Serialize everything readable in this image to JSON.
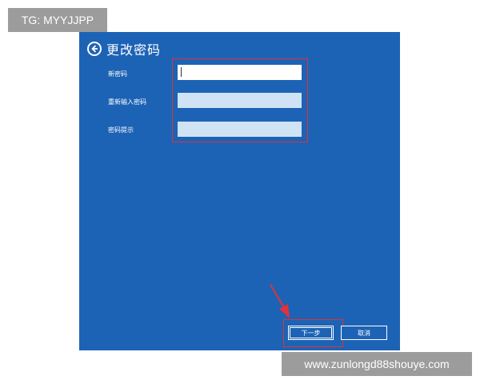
{
  "watermarks": {
    "top": "TG: MYYJJPP",
    "bottom": "www.zunlongd88shouye.com"
  },
  "dialog": {
    "title": "更改密码",
    "fields": [
      {
        "label": "新密码",
        "value": "",
        "active": true
      },
      {
        "label": "重新输入密码",
        "value": "",
        "active": false
      },
      {
        "label": "密码提示",
        "value": "",
        "active": false
      }
    ],
    "buttons": {
      "next": "下一步",
      "cancel": "取消"
    }
  },
  "colors": {
    "dialog_bg": "#1d63b5",
    "highlight": "#e0323a",
    "field_active": "#ffffff",
    "field_inactive": "#cfe3f5"
  },
  "icons": {
    "back": "back-arrow-circle-icon",
    "annotation": "red-arrow-icon"
  }
}
